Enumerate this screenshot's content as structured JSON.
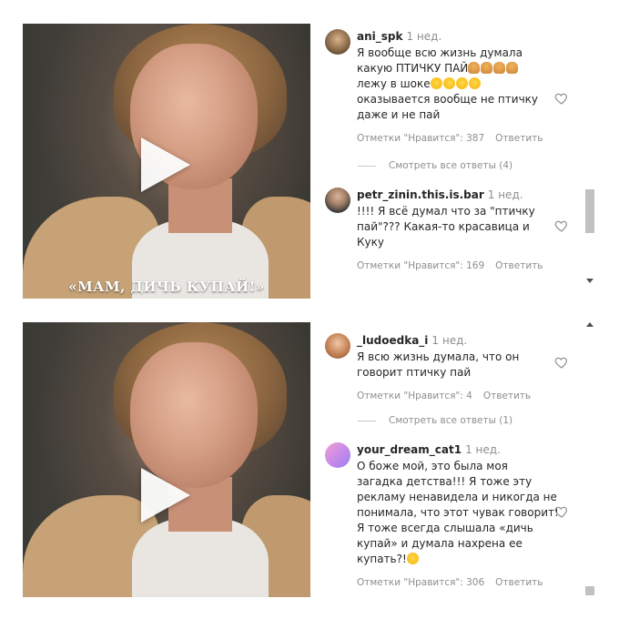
{
  "panels": [
    {
      "video": {
        "caption": "«МАМ, ДИЧЬ КУПАЙ!»"
      },
      "comments": [
        {
          "username": "ani_spk",
          "time": "1 нед.",
          "lines": [
            "Я вообще всю жизнь думала",
            "какую ПТИЧКУ ПАЙ",
            "лежу в шоке",
            "оказывается вообще не птичку",
            "даже и не пай"
          ],
          "likes": "Отметки \"Нравится\": 387",
          "reply": "Ответить",
          "emoji_line2": [
            "person-facepalm",
            "person-facepalm",
            "person-facepalm",
            "person-facepalm"
          ],
          "emoji_line3": [
            "laughing-face",
            "laughing-face",
            "laughing-face",
            "laughing-face"
          ]
        },
        {
          "username": "petr_zinin.this.is.bar",
          "time": "1 нед.",
          "lines": [
            "!!!! Я всё думал что за \"птичку",
            "пай\"??? Какая-то красавица и",
            "Куку"
          ],
          "likes": "Отметки \"Нравится\": 169",
          "reply": "Ответить"
        }
      ],
      "view_replies": "Смотреть все ответы (4)"
    },
    {
      "video": {
        "caption": ""
      },
      "comments": [
        {
          "username": "_ludoedka_i",
          "time": "1 нед.",
          "lines": [
            "Я всю жизнь думала, что он",
            "говорит птичку пай"
          ],
          "likes": "Отметки \"Нравится\": 4",
          "reply": "Ответить"
        },
        {
          "username": "your_dream_cat1",
          "time": "1 нед.",
          "lines": [
            "О боже мой, это была моя",
            "загадка детства!!! Я тоже эту",
            "рекламу ненавидела и никогда не",
            "понимала, что этот чувак говорит!",
            "Я тоже всегда слышала «дичь",
            "купай» и думала нахрена ее",
            "купать?!"
          ],
          "likes": "Отметки \"Нравится\": 306",
          "reply": "Ответить",
          "emoji_end": "sweat-smile-face"
        }
      ],
      "view_replies": "Смотреть все ответы (1)"
    }
  ],
  "icons": {
    "heart": "heart-outline-icon",
    "play": "play-icon"
  }
}
